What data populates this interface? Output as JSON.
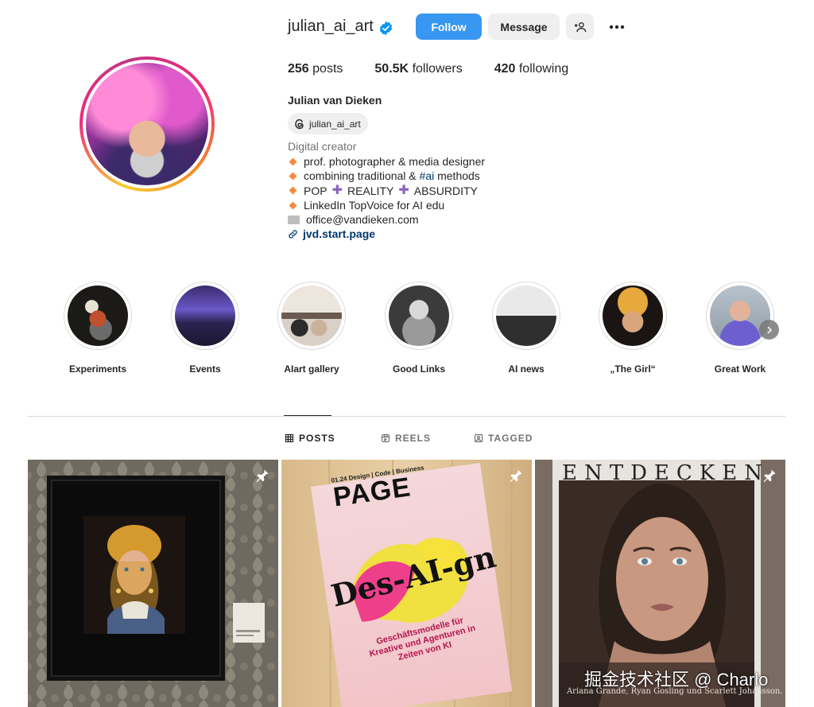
{
  "profile": {
    "username": "julian_ai_art",
    "verified": true,
    "full_name": "Julian van Dieken",
    "threads_handle": "julian_ai_art",
    "category": "Digital creator",
    "link": "jvd.start.page"
  },
  "actions": {
    "follow": "Follow",
    "message": "Message"
  },
  "stats": [
    {
      "value": "256",
      "label": "posts"
    },
    {
      "value": "50.5K",
      "label": "followers"
    },
    {
      "value": "420",
      "label": "following"
    }
  ],
  "bio": {
    "line1": "prof. photographer & media designer",
    "line2_prefix": "combining traditional & ",
    "line2_hashtag": "#ai",
    "line2_suffix": " methods",
    "line3_a": "POP",
    "line3_b": "REALITY",
    "line3_c": "ABSURDITY",
    "line4": "LinkedIn TopVoice for AI edu",
    "line5": "office@vandieken.com"
  },
  "highlights": [
    {
      "label": "Experiments"
    },
    {
      "label": "Events"
    },
    {
      "label": "AIart gallery"
    },
    {
      "label": "Good Links"
    },
    {
      "label": "AI news"
    },
    {
      "label": "„The Girl“"
    },
    {
      "label": "Great Work"
    }
  ],
  "tabs": [
    {
      "label": "POSTS",
      "active": true
    },
    {
      "label": "REELS",
      "active": false
    },
    {
      "label": "TAGGED",
      "active": false
    }
  ],
  "posts": [
    {
      "pinned": true
    },
    {
      "pinned": true,
      "magazine_title": "PAGE",
      "magazine_issue": "01.24 Design | Code | Business",
      "cover_headline": "Des-AI-gn",
      "cover_sub": "Geschäftsmodelle für Kreative und Agenturen in Zeiten von KI"
    },
    {
      "pinned": true,
      "headline": "ENTDECKEN",
      "caption_text": "Ariana Grande, Ryan Gosling und Scarlett Johansson."
    }
  ],
  "watermark": "掘金技术社区 @ Charlo",
  "colors": {
    "follow_blue": "#3897f0",
    "link_blue": "#00376b",
    "text": "#262626",
    "muted": "#737373",
    "verified_blue": "#0095f6"
  }
}
